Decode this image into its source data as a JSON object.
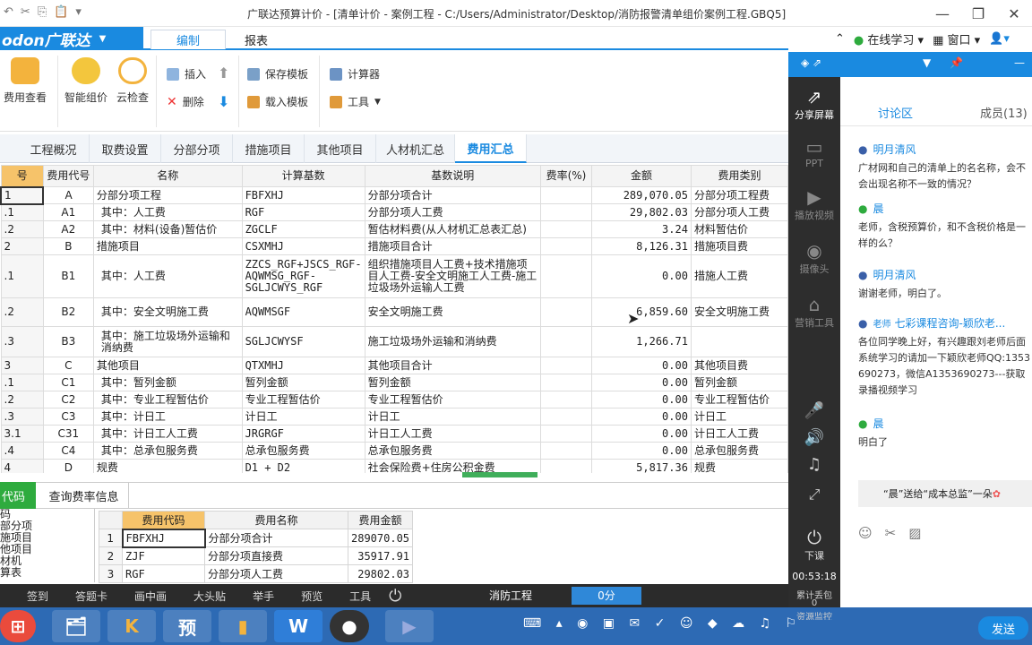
{
  "window": {
    "title": "广联达预算计价 - [清单计价 - 案例工程 - C:/Users/Administrator/Desktop/消防报警清单组价案例工程.GBQ5]"
  },
  "logo": "odon广联达",
  "ribbon_tabs": [
    "编制",
    "报表"
  ],
  "top_right": {
    "online": "在线学习",
    "window": "窗口"
  },
  "ribbon": {
    "fee_view": "费用查看",
    "smart_price": "智能组价",
    "cloud_check": "云检查",
    "insert": "插入",
    "delete": "删除",
    "save_tpl": "保存模板",
    "load_tpl": "载入模板",
    "calculator": "计算器",
    "tools": "工具"
  },
  "sheet_tabs": [
    "工程概况",
    "取费设置",
    "分部分项",
    "措施项目",
    "其他项目",
    "人材机汇总",
    "费用汇总"
  ],
  "main_table": {
    "headers": [
      "号",
      "费用代号",
      "名称",
      "计算基数",
      "基数说明",
      "费率(%)",
      "金额",
      "费用类别"
    ],
    "rows": [
      [
        "1",
        "A",
        "分部分项工程",
        "FBFXHJ",
        "分部分项合计",
        "",
        "289,070.05",
        "分部分项工程费"
      ],
      [
        ".1",
        "A1",
        "其中：人工费",
        "RGF",
        "分部分项人工费",
        "",
        "29,802.03",
        "分部分项人工费"
      ],
      [
        ".2",
        "A2",
        "其中：材料(设备)暂估价",
        "ZGCLF",
        "暂估材料费(从人材机汇总表汇总)",
        "",
        "3.24",
        "材料暂估价"
      ],
      [
        "2",
        "B",
        "措施项目",
        "CSXMHJ",
        "措施项目合计",
        "",
        "8,126.31",
        "措施项目费"
      ],
      [
        ".1",
        "B1",
        "其中：人工费",
        "ZZCS_RGF+JSCS_RGF-AQWMSG_RGF-SGLJCWYS_RGF",
        "组织措施项目人工费+技术措施项目人工费-安全文明施工人工费-施工垃圾场外运输人工费",
        "",
        "0.00",
        "措施人工费"
      ],
      [
        ".2",
        "B2",
        "其中：安全文明施工费",
        "AQWMSGF",
        "安全文明施工费",
        "",
        "6,859.60",
        "安全文明施工费"
      ],
      [
        ".3",
        "B3",
        "其中：施工垃圾场外运输和消纳费",
        "SGLJCWYSF",
        "施工垃圾场外运输和消纳费",
        "",
        "1,266.71",
        ""
      ],
      [
        "3",
        "C",
        "其他项目",
        "QTXMHJ",
        "其他项目合计",
        "",
        "0.00",
        "其他项目费"
      ],
      [
        ".1",
        "C1",
        "其中：暂列金额",
        "暂列金额",
        "暂列金额",
        "",
        "0.00",
        "暂列金额"
      ],
      [
        ".2",
        "C2",
        "其中：专业工程暂估价",
        "专业工程暂估价",
        "专业工程暂估价",
        "",
        "0.00",
        "专业工程暂估价"
      ],
      [
        ".3",
        "C3",
        "其中：计日工",
        "计日工",
        "计日工",
        "",
        "0.00",
        "计日工"
      ],
      [
        "3.1",
        "C31",
        "其中：计日工人工费",
        "JRGRGF",
        "计日工人工费",
        "",
        "0.00",
        "计日工人工费"
      ],
      [
        ".4",
        "C4",
        "其中：总承包服务费",
        "总承包服务费",
        "总承包服务费",
        "",
        "0.00",
        "总承包服务费"
      ],
      [
        "4",
        "D",
        "规费",
        "D1 + D2",
        "社会保险费+住房公积金费",
        "",
        "5,817.36",
        "规费"
      ]
    ]
  },
  "bottom": {
    "tab_code": "代码",
    "tab_rate": "查询费率信息",
    "tree": [
      "码",
      "部分项",
      "施项目",
      "他项目",
      "材机",
      "算表"
    ],
    "sub_headers": [
      "费用代码",
      "费用名称",
      "费用金额"
    ],
    "sub_rows": [
      [
        "1",
        "FBFXHJ",
        "分部分项合计",
        "289070.05"
      ],
      [
        "2",
        "ZJF",
        "分部分项直接费",
        "35917.91"
      ],
      [
        "3",
        "RGF",
        "分部分项人工费",
        "29802.03"
      ]
    ]
  },
  "live_toolbar": [
    "签到",
    "答题卡",
    "画中画",
    "大头贴",
    "举手",
    "预览",
    "工具"
  ],
  "status": {
    "project": "消防工程",
    "score": "0分"
  },
  "side_tools": {
    "share": "分享屏幕",
    "ppt": "PPT",
    "video": "播放视频",
    "camera": "摄像头",
    "marketing": "营销工具",
    "leave": "下课",
    "time": "00:53:18",
    "gifts": "累计丢包",
    "gifts_val": "0",
    "resource": "资源监控"
  },
  "chat": {
    "tab_discuss": "讨论区",
    "tab_members": "成员(13)",
    "messages": [
      {
        "name": "明月清风",
        "text": "广材网和自己的清单上的名名称，会不会出现名称不一致的情况？"
      },
      {
        "name": "晨",
        "text": "老师，含税预算价，和不含税价格是一样的么？"
      },
      {
        "name": "明月清风",
        "text": "谢谢老师，明白了。"
      },
      {
        "name": "七彩课程咨询-颖欣老...",
        "role": "老师",
        "text": "各位同学晚上好，有兴趣跟刘老师后面系统学习的请加一下颖欣老师QQ:1353690273，微信A1353690273---获取录播视频学习"
      },
      {
        "name": "晨",
        "text": "明白了"
      }
    ],
    "gift": "“晨”送给“成本总监”一朵",
    "send": "发送"
  },
  "taskbar_icons": [
    "win",
    "folder",
    "K",
    "预",
    "ruler",
    "W",
    "avatar",
    "app"
  ]
}
